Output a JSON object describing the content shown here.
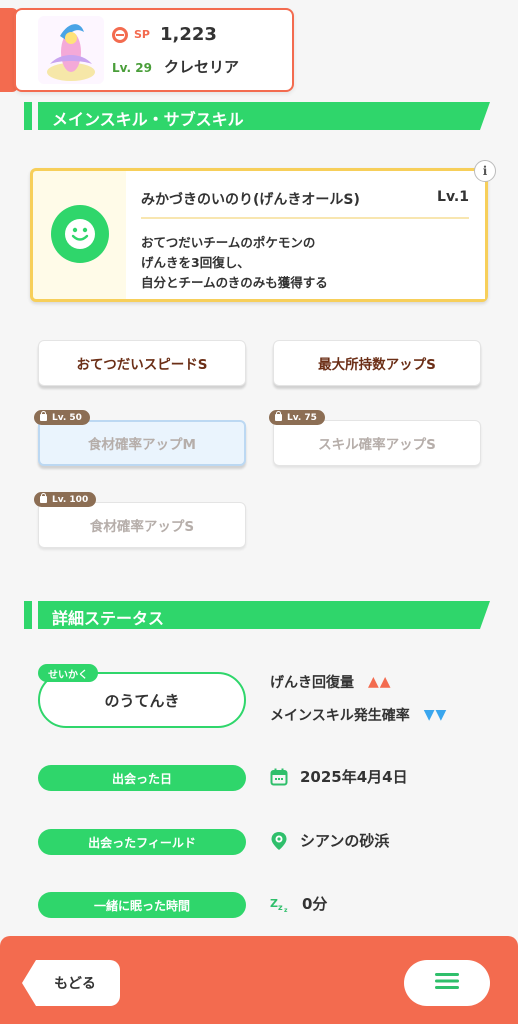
{
  "header": {
    "sp_label": "SP",
    "sp_value": "1,223",
    "level_label": "Lv.",
    "level_value": "29",
    "pokemon_name": "クレセリア"
  },
  "sections": {
    "skills_title": "メインスキル・サブスキル",
    "status_title": "詳細ステータス"
  },
  "main_skill": {
    "name": "みかづきのいのり(げんきオールS)",
    "level": "Lv.1",
    "description_lines": [
      "おてつだいチームのポケモンの",
      "げんきを3回復し、",
      "自分とチームのきのみも獲得する"
    ],
    "info_icon": "i"
  },
  "sub_skills": [
    {
      "label": "おてつだいスピードS",
      "lock": ""
    },
    {
      "label": "最大所持数アップS",
      "lock": ""
    },
    {
      "label": "食材確率アップM",
      "lock": "Lv. 50"
    },
    {
      "label": "スキル確率アップS",
      "lock": "Lv. 75"
    },
    {
      "label": "食材確率アップS",
      "lock": "Lv. 100"
    }
  ],
  "status": {
    "nature_tag": "せいかく",
    "nature": "のうてんき",
    "effect_up": "げんき回復量",
    "effect_down": "メインスキル発生確率",
    "up_arrows": "▲▲",
    "down_arrows": "▼▼",
    "met_date_label": "出会った日",
    "met_date": "2025年4月4日",
    "met_field_label": "出会ったフィールド",
    "met_field": "シアンの砂浜",
    "slept_label": "一緒に眠った時間",
    "slept_value": "0分"
  },
  "footer": {
    "back_label": "もどる"
  },
  "colors": {
    "accent": "#f36b4f",
    "green": "#2fd66b",
    "yellow": "#f7cf5a",
    "up": "#f36b4f",
    "down": "#3aa6ee"
  }
}
